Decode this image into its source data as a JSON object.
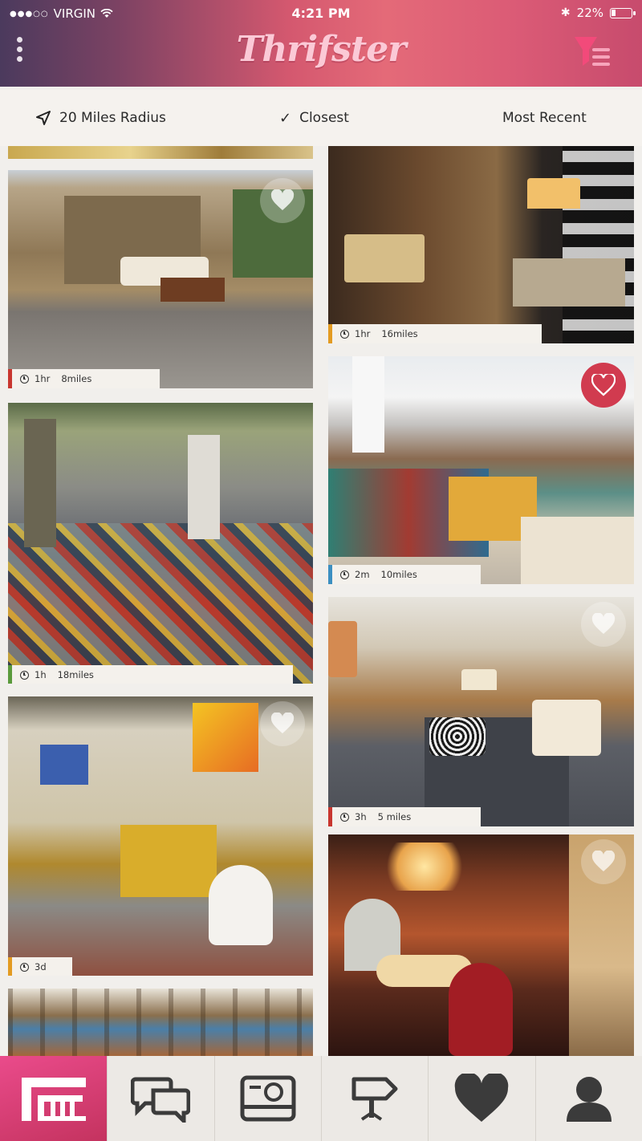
{
  "status": {
    "carrier": "VIRGIN",
    "time": "4:21 PM",
    "battery": "22%",
    "battery_level": 0.22
  },
  "header": {
    "app_title": "Thrifster"
  },
  "filters": {
    "radius": "20 Miles Radius",
    "closest": "Closest",
    "recent": "Most Recent"
  },
  "feed": {
    "left": [
      {
        "time": "1hr",
        "distance": "8miles",
        "accent": "#c8362f",
        "favorited": false
      },
      {
        "time": "1h",
        "distance": "18miles",
        "accent": "#5a9a3c",
        "favorited": false
      },
      {
        "time": "3d",
        "distance": "",
        "accent": "#e39b22",
        "favorited": false
      },
      {
        "time": "",
        "distance": "",
        "accent": "",
        "favorited": false
      }
    ],
    "right": [
      {
        "time": "1hr",
        "distance": "16miles",
        "accent": "#e39b22",
        "favorited": false
      },
      {
        "time": "2m",
        "distance": "10miles",
        "accent": "#3b8fc1",
        "favorited": true
      },
      {
        "time": "3h",
        "distance": "5 miles",
        "accent": "#c8362f",
        "favorited": false
      },
      {
        "time": "",
        "distance": "",
        "accent": "",
        "favorited": false
      }
    ]
  },
  "tabs": [
    {
      "icon": "store-icon",
      "active": true
    },
    {
      "icon": "chat-icon",
      "active": false
    },
    {
      "icon": "camera-icon",
      "active": false
    },
    {
      "icon": "signpost-icon",
      "active": false
    },
    {
      "icon": "heart-icon",
      "active": false
    },
    {
      "icon": "profile-icon",
      "active": false
    }
  ],
  "colors": {
    "brand_pink": "#e0507a",
    "favorite_red": "#d13b4f"
  }
}
